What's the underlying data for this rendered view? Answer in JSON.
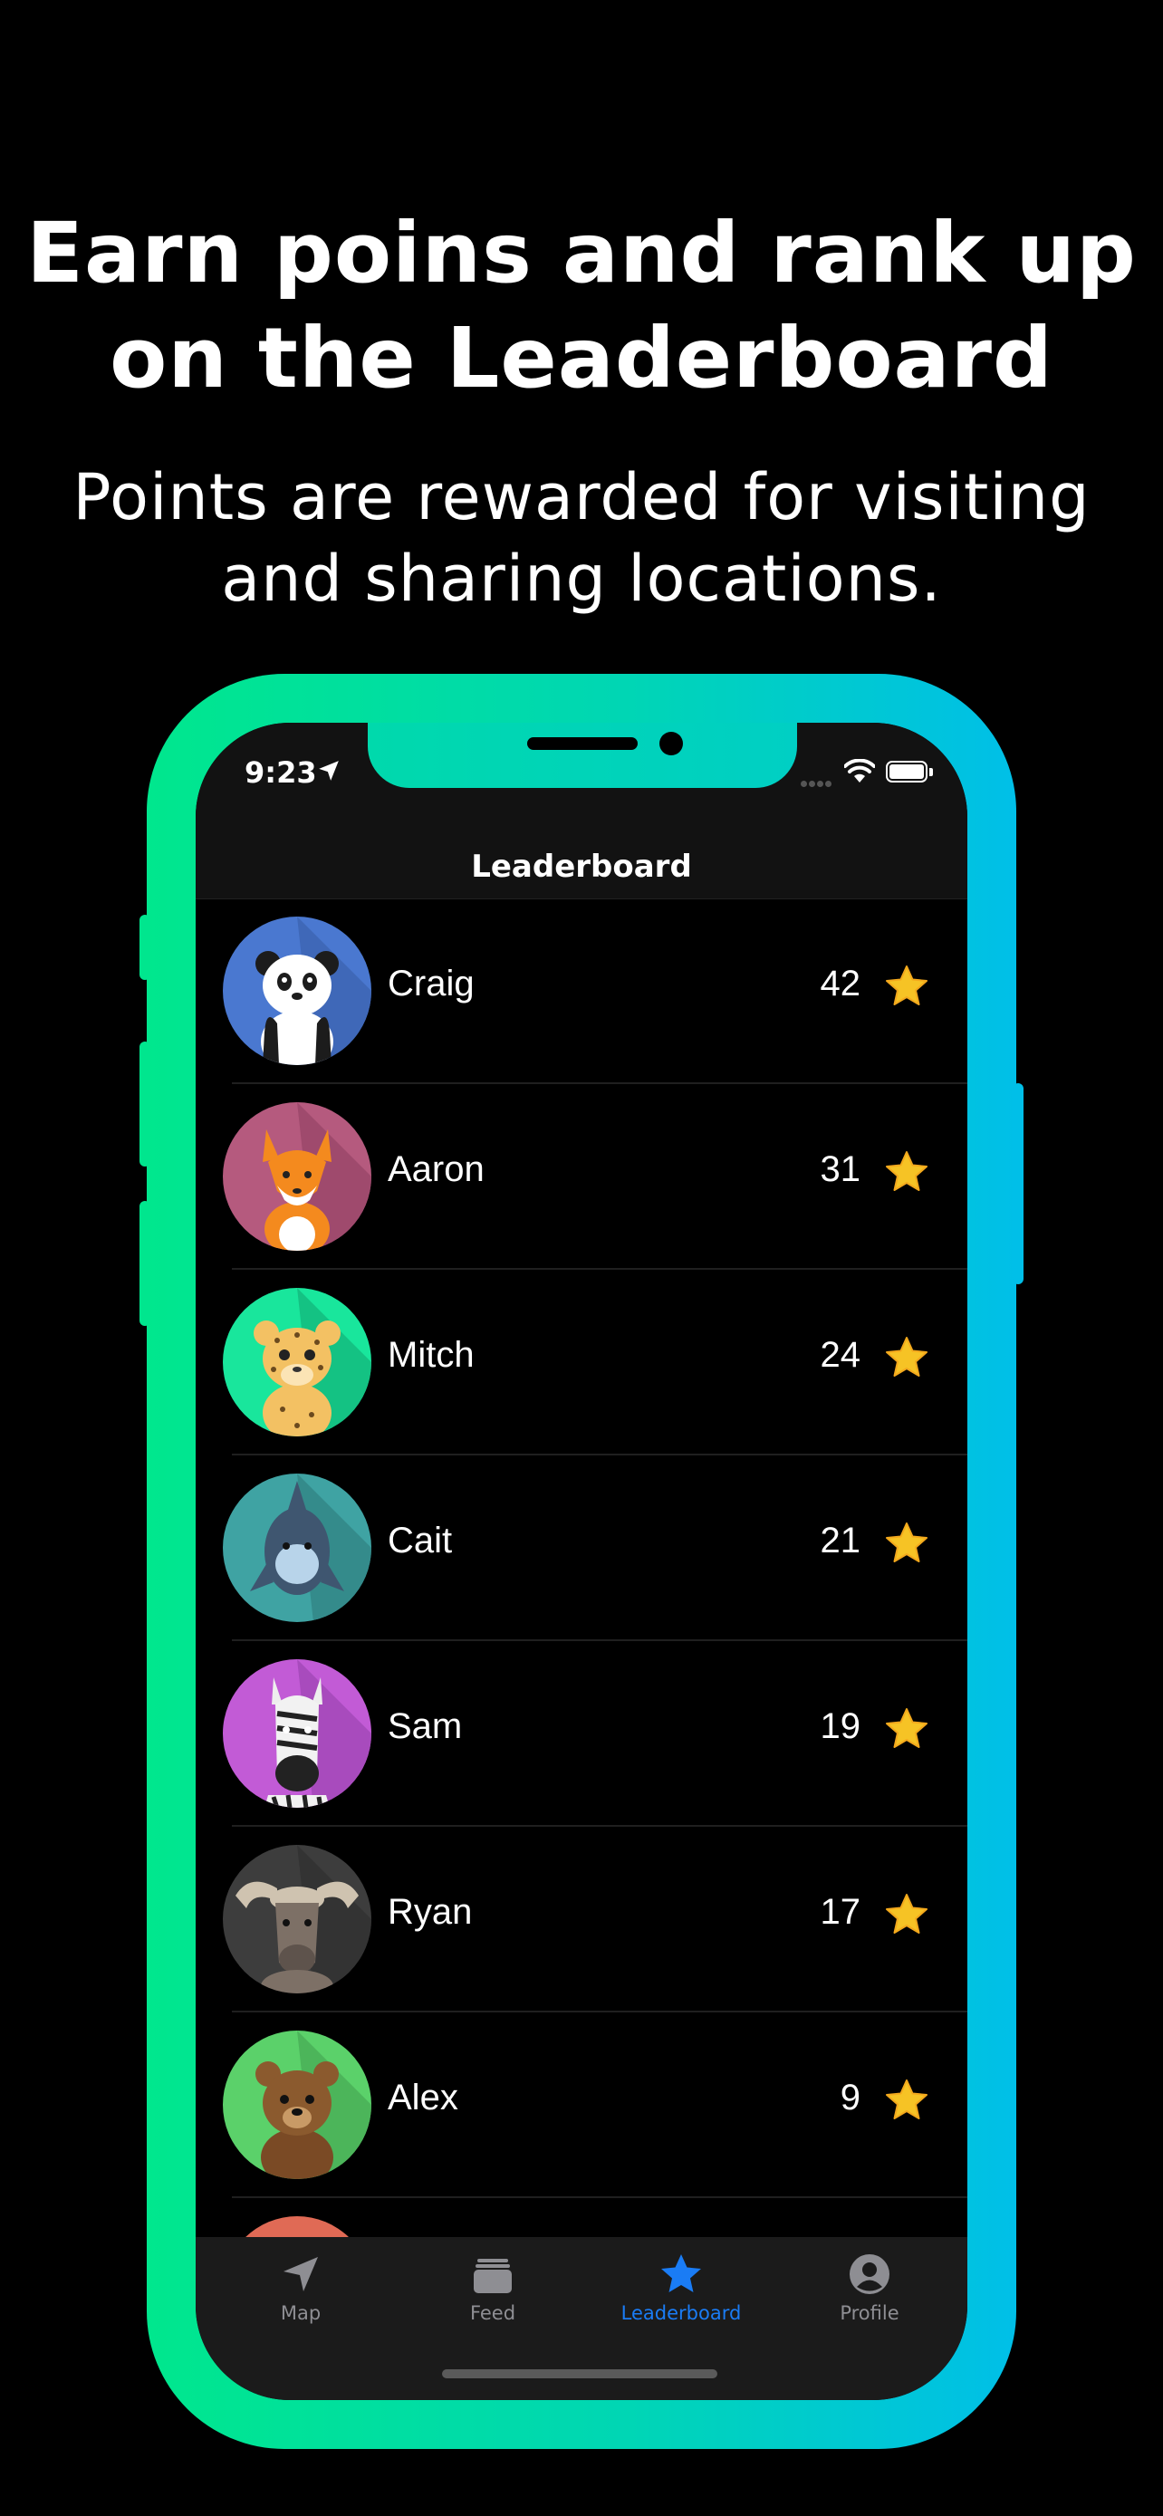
{
  "promo": {
    "headline_line1": "Earn poins and rank up",
    "headline_line2": "on the Leaderboard",
    "subhead_line1": "Points are rewarded for visiting",
    "subhead_line2": "and sharing locations."
  },
  "status_bar": {
    "time": "9:23"
  },
  "nav": {
    "title": "Leaderboard"
  },
  "leaderboard": [
    {
      "name": "Craig",
      "points": "42",
      "animal": "panda",
      "bg": "#4a78d0"
    },
    {
      "name": "Aaron",
      "points": "31",
      "animal": "fox",
      "bg": "#b55a7e"
    },
    {
      "name": "Mitch",
      "points": "24",
      "animal": "leopard",
      "bg": "#19e69c"
    },
    {
      "name": "Cait",
      "points": "21",
      "animal": "dolphin",
      "bg": "#3fa3a3"
    },
    {
      "name": "Sam",
      "points": "19",
      "animal": "zebra",
      "bg": "#c25bd6"
    },
    {
      "name": "Ryan",
      "points": "17",
      "animal": "buffalo",
      "bg": "#3d3d3d"
    },
    {
      "name": "Alex",
      "points": "9",
      "animal": "bear",
      "bg": "#5bd16a"
    }
  ],
  "tabs": [
    {
      "label": "Map",
      "icon": "location-arrow-icon"
    },
    {
      "label": "Feed",
      "icon": "feed-icon"
    },
    {
      "label": "Leaderboard",
      "icon": "star-icon",
      "active": true
    },
    {
      "label": "Profile",
      "icon": "person-circle-icon"
    }
  ],
  "colors": {
    "accent": "#1a7cf5",
    "gradient_start": "#00e78d",
    "gradient_end": "#00bfe8",
    "star": "#f6c325"
  }
}
